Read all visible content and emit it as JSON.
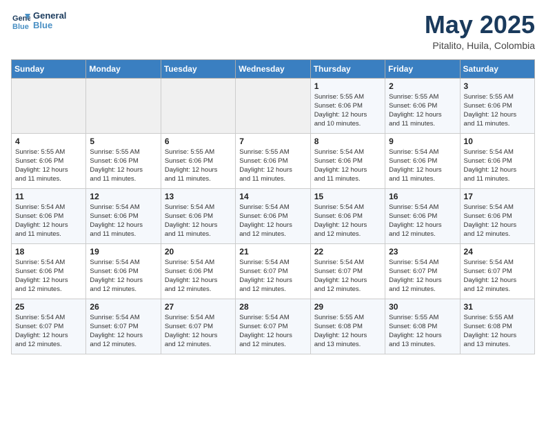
{
  "logo": {
    "line1": "General",
    "line2": "Blue"
  },
  "title": "May 2025",
  "subtitle": "Pitalito, Huila, Colombia",
  "weekdays": [
    "Sunday",
    "Monday",
    "Tuesday",
    "Wednesday",
    "Thursday",
    "Friday",
    "Saturday"
  ],
  "weeks": [
    [
      {
        "day": "",
        "detail": ""
      },
      {
        "day": "",
        "detail": ""
      },
      {
        "day": "",
        "detail": ""
      },
      {
        "day": "",
        "detail": ""
      },
      {
        "day": "1",
        "detail": "Sunrise: 5:55 AM\nSunset: 6:06 PM\nDaylight: 12 hours\nand 10 minutes."
      },
      {
        "day": "2",
        "detail": "Sunrise: 5:55 AM\nSunset: 6:06 PM\nDaylight: 12 hours\nand 11 minutes."
      },
      {
        "day": "3",
        "detail": "Sunrise: 5:55 AM\nSunset: 6:06 PM\nDaylight: 12 hours\nand 11 minutes."
      }
    ],
    [
      {
        "day": "4",
        "detail": "Sunrise: 5:55 AM\nSunset: 6:06 PM\nDaylight: 12 hours\nand 11 minutes."
      },
      {
        "day": "5",
        "detail": "Sunrise: 5:55 AM\nSunset: 6:06 PM\nDaylight: 12 hours\nand 11 minutes."
      },
      {
        "day": "6",
        "detail": "Sunrise: 5:55 AM\nSunset: 6:06 PM\nDaylight: 12 hours\nand 11 minutes."
      },
      {
        "day": "7",
        "detail": "Sunrise: 5:55 AM\nSunset: 6:06 PM\nDaylight: 12 hours\nand 11 minutes."
      },
      {
        "day": "8",
        "detail": "Sunrise: 5:54 AM\nSunset: 6:06 PM\nDaylight: 12 hours\nand 11 minutes."
      },
      {
        "day": "9",
        "detail": "Sunrise: 5:54 AM\nSunset: 6:06 PM\nDaylight: 12 hours\nand 11 minutes."
      },
      {
        "day": "10",
        "detail": "Sunrise: 5:54 AM\nSunset: 6:06 PM\nDaylight: 12 hours\nand 11 minutes."
      }
    ],
    [
      {
        "day": "11",
        "detail": "Sunrise: 5:54 AM\nSunset: 6:06 PM\nDaylight: 12 hours\nand 11 minutes."
      },
      {
        "day": "12",
        "detail": "Sunrise: 5:54 AM\nSunset: 6:06 PM\nDaylight: 12 hours\nand 11 minutes."
      },
      {
        "day": "13",
        "detail": "Sunrise: 5:54 AM\nSunset: 6:06 PM\nDaylight: 12 hours\nand 11 minutes."
      },
      {
        "day": "14",
        "detail": "Sunrise: 5:54 AM\nSunset: 6:06 PM\nDaylight: 12 hours\nand 12 minutes."
      },
      {
        "day": "15",
        "detail": "Sunrise: 5:54 AM\nSunset: 6:06 PM\nDaylight: 12 hours\nand 12 minutes."
      },
      {
        "day": "16",
        "detail": "Sunrise: 5:54 AM\nSunset: 6:06 PM\nDaylight: 12 hours\nand 12 minutes."
      },
      {
        "day": "17",
        "detail": "Sunrise: 5:54 AM\nSunset: 6:06 PM\nDaylight: 12 hours\nand 12 minutes."
      }
    ],
    [
      {
        "day": "18",
        "detail": "Sunrise: 5:54 AM\nSunset: 6:06 PM\nDaylight: 12 hours\nand 12 minutes."
      },
      {
        "day": "19",
        "detail": "Sunrise: 5:54 AM\nSunset: 6:06 PM\nDaylight: 12 hours\nand 12 minutes."
      },
      {
        "day": "20",
        "detail": "Sunrise: 5:54 AM\nSunset: 6:06 PM\nDaylight: 12 hours\nand 12 minutes."
      },
      {
        "day": "21",
        "detail": "Sunrise: 5:54 AM\nSunset: 6:07 PM\nDaylight: 12 hours\nand 12 minutes."
      },
      {
        "day": "22",
        "detail": "Sunrise: 5:54 AM\nSunset: 6:07 PM\nDaylight: 12 hours\nand 12 minutes."
      },
      {
        "day": "23",
        "detail": "Sunrise: 5:54 AM\nSunset: 6:07 PM\nDaylight: 12 hours\nand 12 minutes."
      },
      {
        "day": "24",
        "detail": "Sunrise: 5:54 AM\nSunset: 6:07 PM\nDaylight: 12 hours\nand 12 minutes."
      }
    ],
    [
      {
        "day": "25",
        "detail": "Sunrise: 5:54 AM\nSunset: 6:07 PM\nDaylight: 12 hours\nand 12 minutes."
      },
      {
        "day": "26",
        "detail": "Sunrise: 5:54 AM\nSunset: 6:07 PM\nDaylight: 12 hours\nand 12 minutes."
      },
      {
        "day": "27",
        "detail": "Sunrise: 5:54 AM\nSunset: 6:07 PM\nDaylight: 12 hours\nand 12 minutes."
      },
      {
        "day": "28",
        "detail": "Sunrise: 5:54 AM\nSunset: 6:07 PM\nDaylight: 12 hours\nand 12 minutes."
      },
      {
        "day": "29",
        "detail": "Sunrise: 5:55 AM\nSunset: 6:08 PM\nDaylight: 12 hours\nand 13 minutes."
      },
      {
        "day": "30",
        "detail": "Sunrise: 5:55 AM\nSunset: 6:08 PM\nDaylight: 12 hours\nand 13 minutes."
      },
      {
        "day": "31",
        "detail": "Sunrise: 5:55 AM\nSunset: 6:08 PM\nDaylight: 12 hours\nand 13 minutes."
      }
    ]
  ]
}
